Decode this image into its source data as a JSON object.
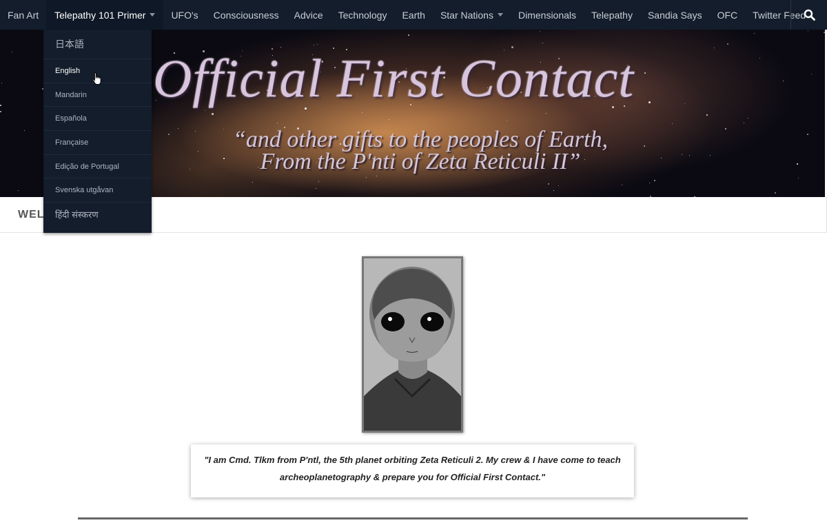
{
  "nav": {
    "items": [
      "Fan Art",
      "Telepathy 101 Primer",
      "UFO's",
      "Consciousness",
      "Advice",
      "Technology",
      "Earth",
      "Star Nations",
      "Dimensionals",
      "Telepathy",
      "Sandia Says",
      "OFC",
      "Twitter Feed"
    ],
    "active": "Telepathy 101 Primer",
    "search_icon": "search-icon"
  },
  "dropdown": {
    "items": [
      "日本語",
      "English",
      "Mandarin",
      "Española",
      "Française",
      "Edição de Portugal",
      "Svenska utgåvan",
      "हिंदी संस्करण"
    ],
    "hovered": "English"
  },
  "banner": {
    "title": "Official First Contact",
    "subtitle_line1": "“and other gifts to the peoples of Earth,",
    "subtitle_line2": "From the P'nti of Zeta Reticuli II”"
  },
  "page": {
    "heading": "WELCOME"
  },
  "quote": {
    "text": "\"I am Cmd. Tlkm from P'ntl, the 5th planet orbiting Zeta Reticuli 2. My crew & I have come to teach archeoplanetography & prepare you for Official First Contact.\""
  },
  "colors": {
    "nav_bg": "#131d2b",
    "text": "#c9ced6"
  }
}
